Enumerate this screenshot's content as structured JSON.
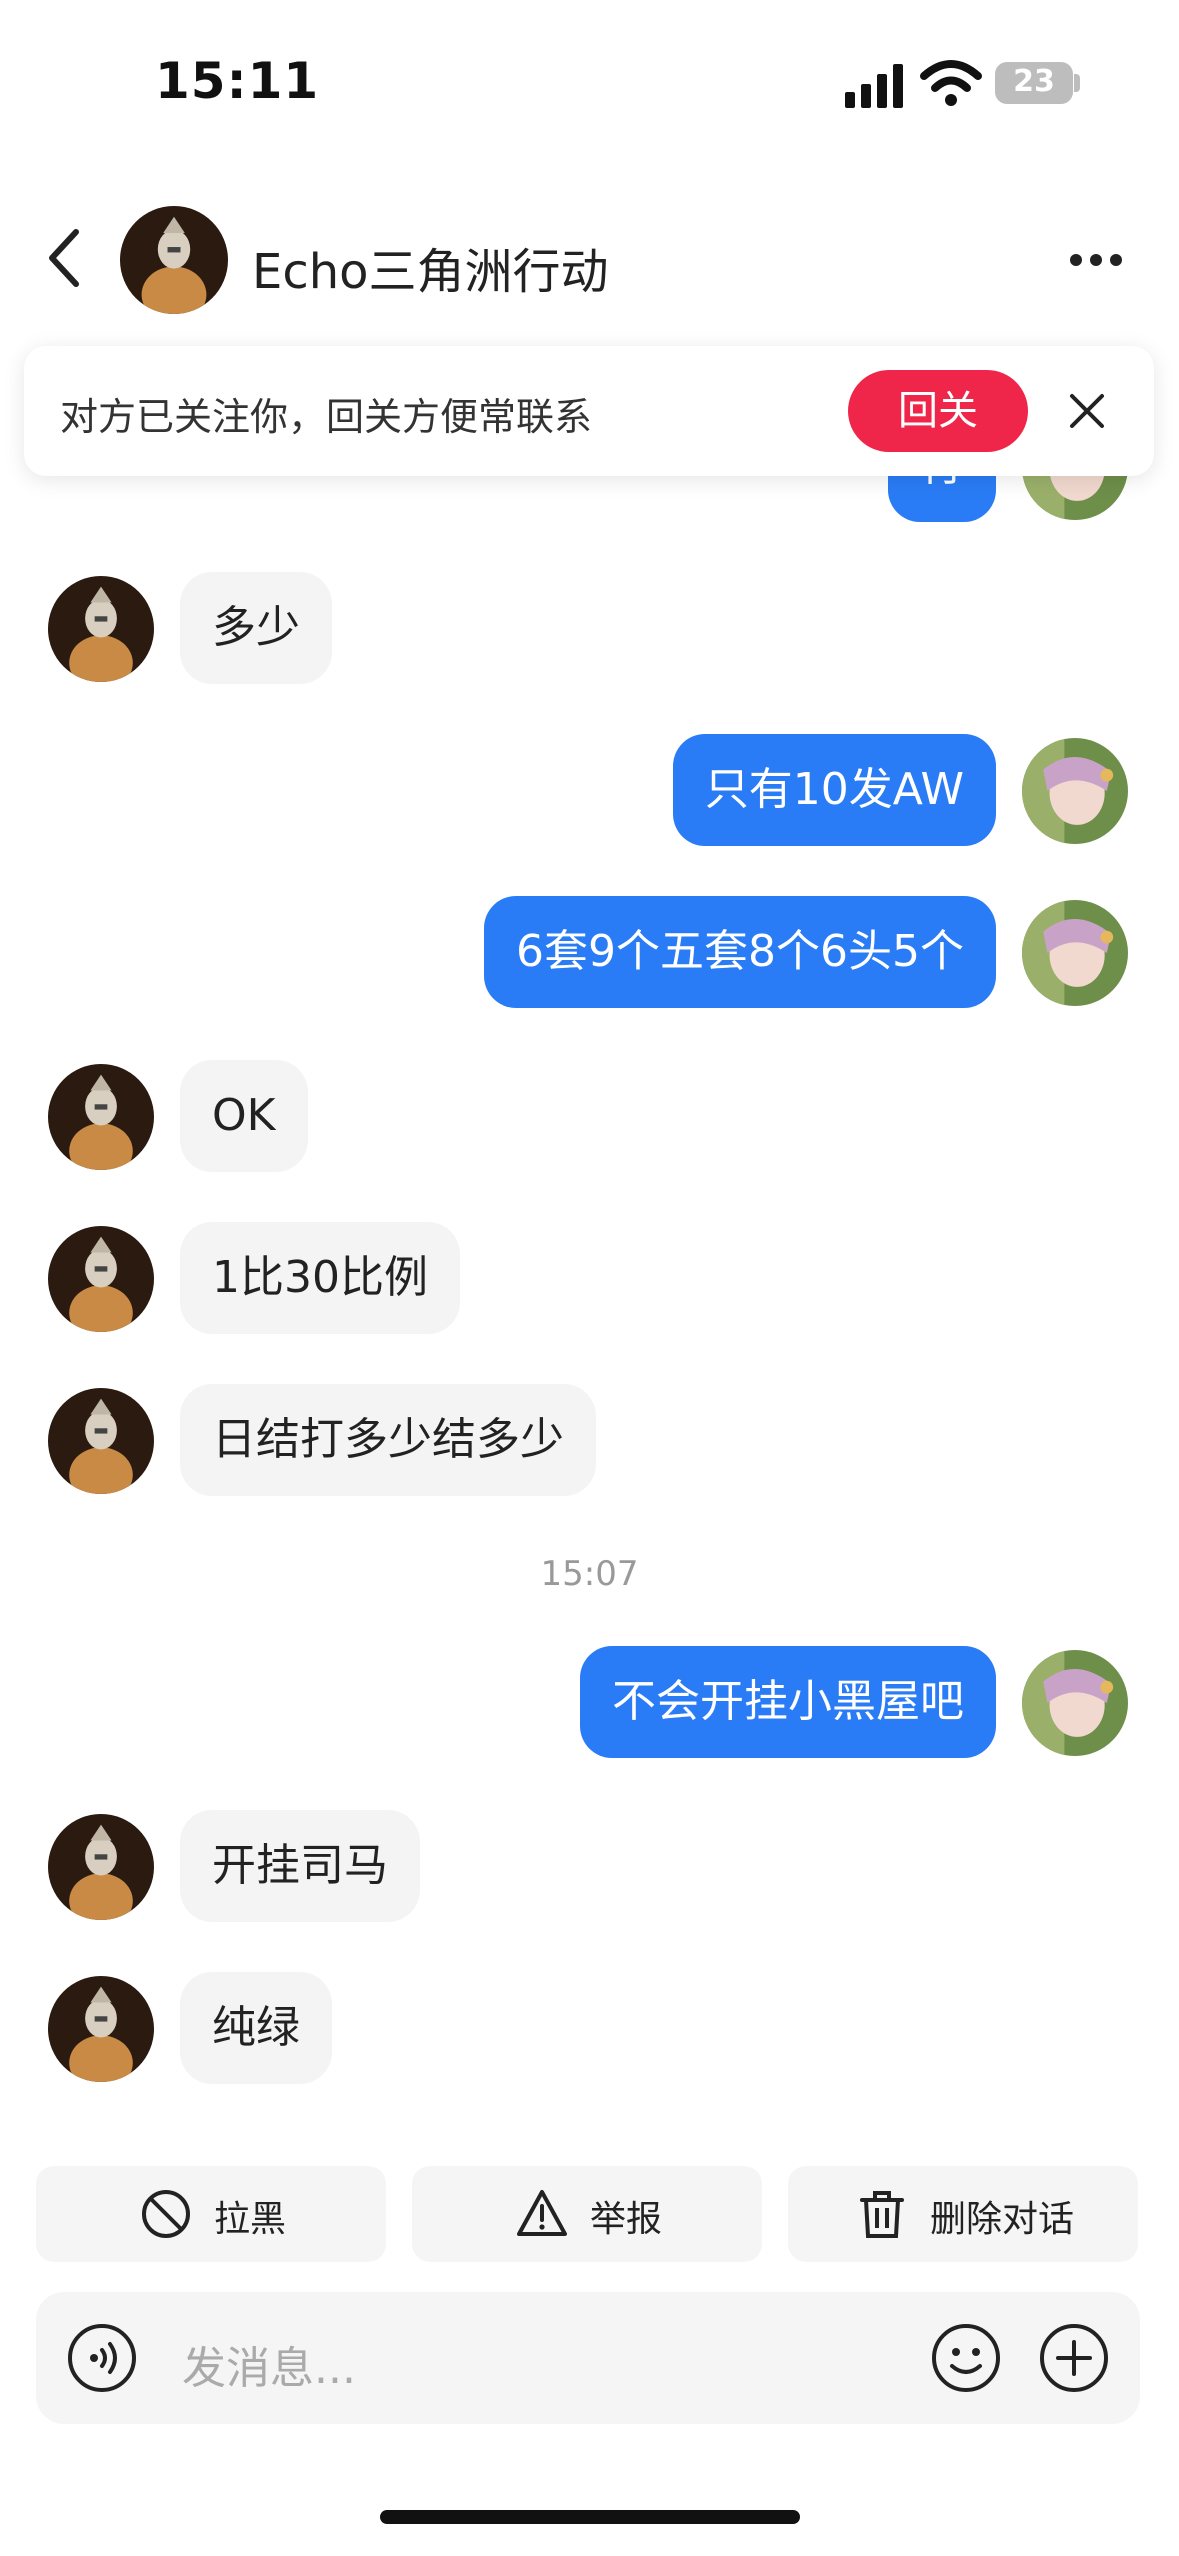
{
  "status_bar": {
    "time": "15:11",
    "battery": "23"
  },
  "header": {
    "contact_name": "Echo三角洲行动"
  },
  "follow_banner": {
    "text": "对方已关注你，回关方便常联系",
    "button": "回关"
  },
  "messages": [
    {
      "side": "out",
      "text": "行"
    },
    {
      "side": "in",
      "text": "多少"
    },
    {
      "side": "out",
      "text": "只有10发AW"
    },
    {
      "side": "out",
      "text": "6套9个五套8个6头5个"
    },
    {
      "side": "in",
      "text": "OK"
    },
    {
      "side": "in",
      "text": "1比30比例"
    },
    {
      "side": "in",
      "text": "日结打多少结多少"
    },
    {
      "side": "out",
      "text": "不会开挂小黑屋吧"
    },
    {
      "side": "in",
      "text": "开挂司马"
    },
    {
      "side": "in",
      "text": "纯绿"
    }
  ],
  "timestamp": "15:07",
  "actions": {
    "block": "拉黑",
    "report": "举报",
    "delete": "删除对话"
  },
  "input": {
    "placeholder": "发消息..."
  },
  "colors": {
    "outgoing_bubble": "#2a7cf6",
    "incoming_bubble": "#f4f4f4",
    "follow_button": "#f0254a"
  },
  "icons": [
    "back-icon",
    "more-icon",
    "close-icon",
    "block-icon",
    "warning-icon",
    "trash-icon",
    "voice-icon",
    "emoji-icon",
    "plus-icon"
  ]
}
